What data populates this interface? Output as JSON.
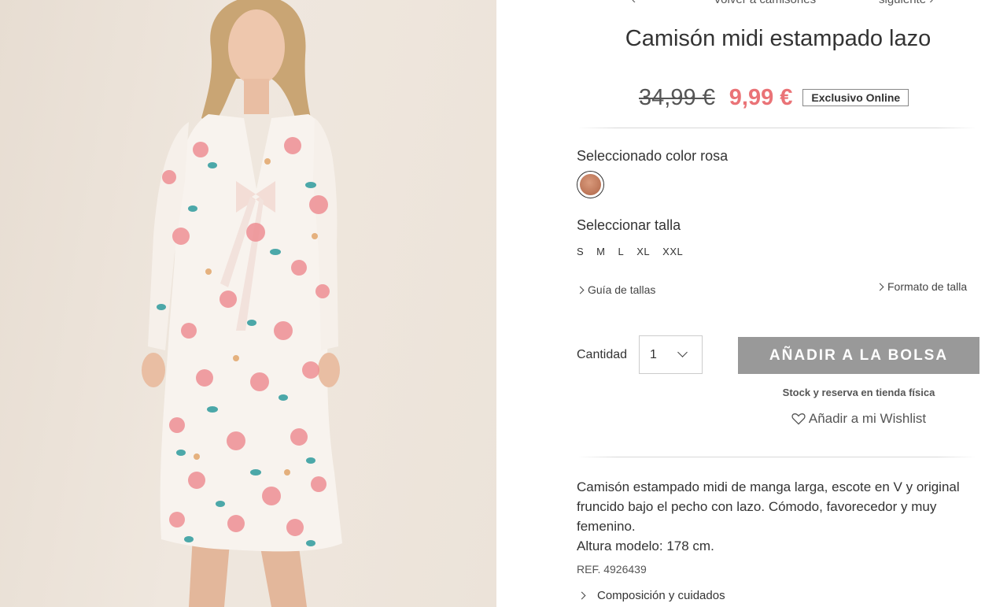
{
  "nav": {
    "back_label": "Volver a camisones",
    "next_label": "siguiente"
  },
  "product": {
    "title": "Camisón midi estampado lazo",
    "old_price": "34,99 €",
    "new_price": "9,99 €",
    "badge": "Exclusivo Online",
    "color_label": "Seleccionado color rosa",
    "swatch_color": "#c07a5c",
    "size_label": "Seleccionar talla",
    "sizes": [
      "S",
      "M",
      "L",
      "XL",
      "XXL"
    ],
    "size_guide": "Guía de tallas",
    "size_format": "Formato de talla",
    "quantity_label": "Cantidad",
    "quantity_value": "1",
    "add_button": "AÑADIR A LA BOLSA",
    "stock_link": "Stock y reserva en tienda física",
    "wishlist": "Añadir a mi Wishlist",
    "description": [
      "Camisón estampado midi de manga larga, escote en V y original fruncido bajo el pecho con lazo. Cómodo, favorecedor y muy femenino.",
      "Altura modelo: 178 cm."
    ],
    "ref": "REF. 4926439",
    "composition": "Composición y cuidados"
  },
  "colors": {
    "sale_price": "#ea7377",
    "button_bg": "#999999"
  }
}
